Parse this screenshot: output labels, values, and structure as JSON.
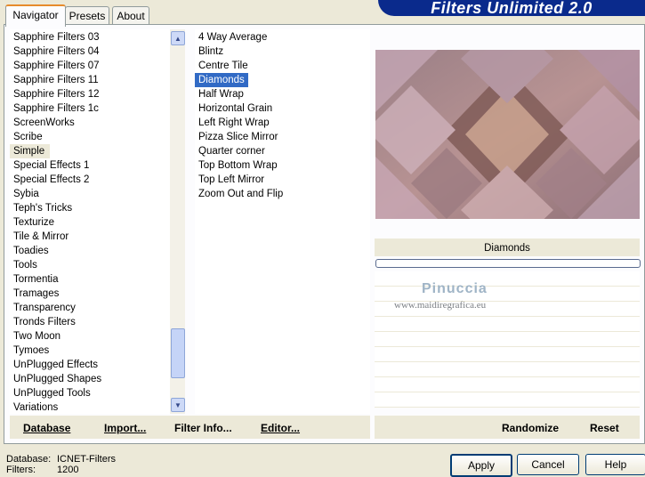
{
  "window": {
    "title": "Filters Unlimited 2.0"
  },
  "tabs": [
    {
      "label": "Navigator",
      "active": true
    },
    {
      "label": "Presets",
      "active": false
    },
    {
      "label": "About",
      "active": false
    }
  ],
  "categories": {
    "items": [
      "Sapphire Filters 03",
      "Sapphire Filters 04",
      "Sapphire Filters 07",
      "Sapphire Filters 11",
      "Sapphire Filters 12",
      "Sapphire Filters 1c",
      "ScreenWorks",
      "Scribe",
      "Simple",
      "Special Effects 1",
      "Special Effects 2",
      "Sybia",
      "Teph's Tricks",
      "Texturize",
      "Tile & Mirror",
      "Toadies",
      "Tools",
      "Tormentia",
      "Tramages",
      "Transparency",
      "Tronds Filters",
      "Two Moon",
      "Tymoes",
      "UnPlugged Effects",
      "UnPlugged Shapes",
      "UnPlugged Tools",
      "Variations"
    ],
    "selected": "Simple"
  },
  "filters": {
    "items": [
      "4 Way Average",
      "Blintz",
      "Centre Tile",
      "Diamonds",
      "Half Wrap",
      "Horizontal Grain",
      "Left Right Wrap",
      "Pizza Slice Mirror",
      "Quarter corner",
      "Top Bottom Wrap",
      "Top Left Mirror",
      "Zoom Out and Flip"
    ],
    "selected": "Diamonds"
  },
  "bottom_bar": {
    "database": "Database",
    "import": "Import...",
    "filter_info": "Filter Info...",
    "editor": "Editor...",
    "randomize": "Randomize",
    "reset": "Reset"
  },
  "preview": {
    "filter_name": "Diamonds"
  },
  "watermark": {
    "name": "Pinuccia",
    "url": "www.maidiregrafica.eu"
  },
  "status": {
    "database_label": "Database:",
    "database_value": "ICNET-Filters",
    "filters_label": "Filters:",
    "filters_value": "1200"
  },
  "buttons": {
    "apply": "Apply",
    "cancel": "Cancel",
    "help": "Help"
  },
  "colors": {
    "selection": "#316ac5",
    "banner": "#0a2a8c",
    "tab_accent": "#e68b2c"
  }
}
